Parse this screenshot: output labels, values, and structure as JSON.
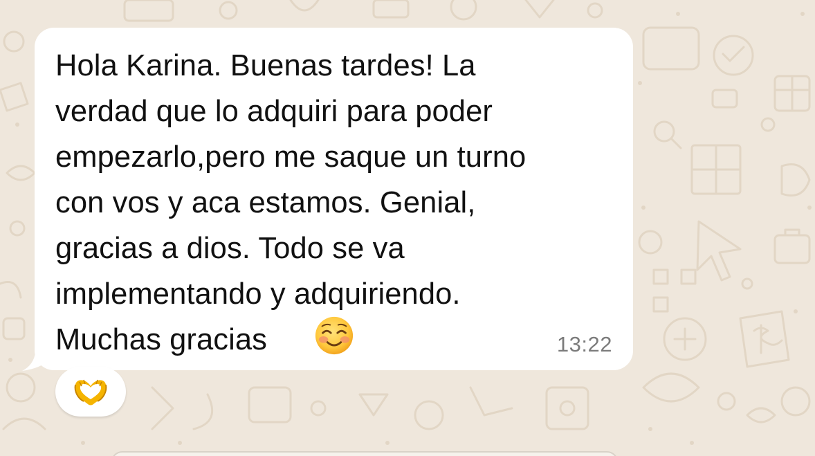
{
  "chat": {
    "message": {
      "lines": [
        "Hola Karina. Buenas tardes! La",
        "verdad que lo adquiri para poder",
        "empezarlo,pero me saque un turno",
        "con vos y aca estamos. Genial,",
        "gracias a dios. Todo se va",
        "implementando y adquiriendo.",
        "Muchas gracias"
      ],
      "emoji": "smiling-face-emoji",
      "time": "13:22"
    },
    "reaction": {
      "emoji": "heart-hands-emoji"
    }
  },
  "colors": {
    "wallpaper": "#efe7dc",
    "wallpaper_doodle": "#e3d8c8",
    "bubble": "#ffffff",
    "text": "#111111",
    "timestamp": "#7b7b7b",
    "emoji_face": "#ffc83d",
    "emoji_blush": "#f28b6c",
    "reaction_hands": "#f5b400"
  }
}
